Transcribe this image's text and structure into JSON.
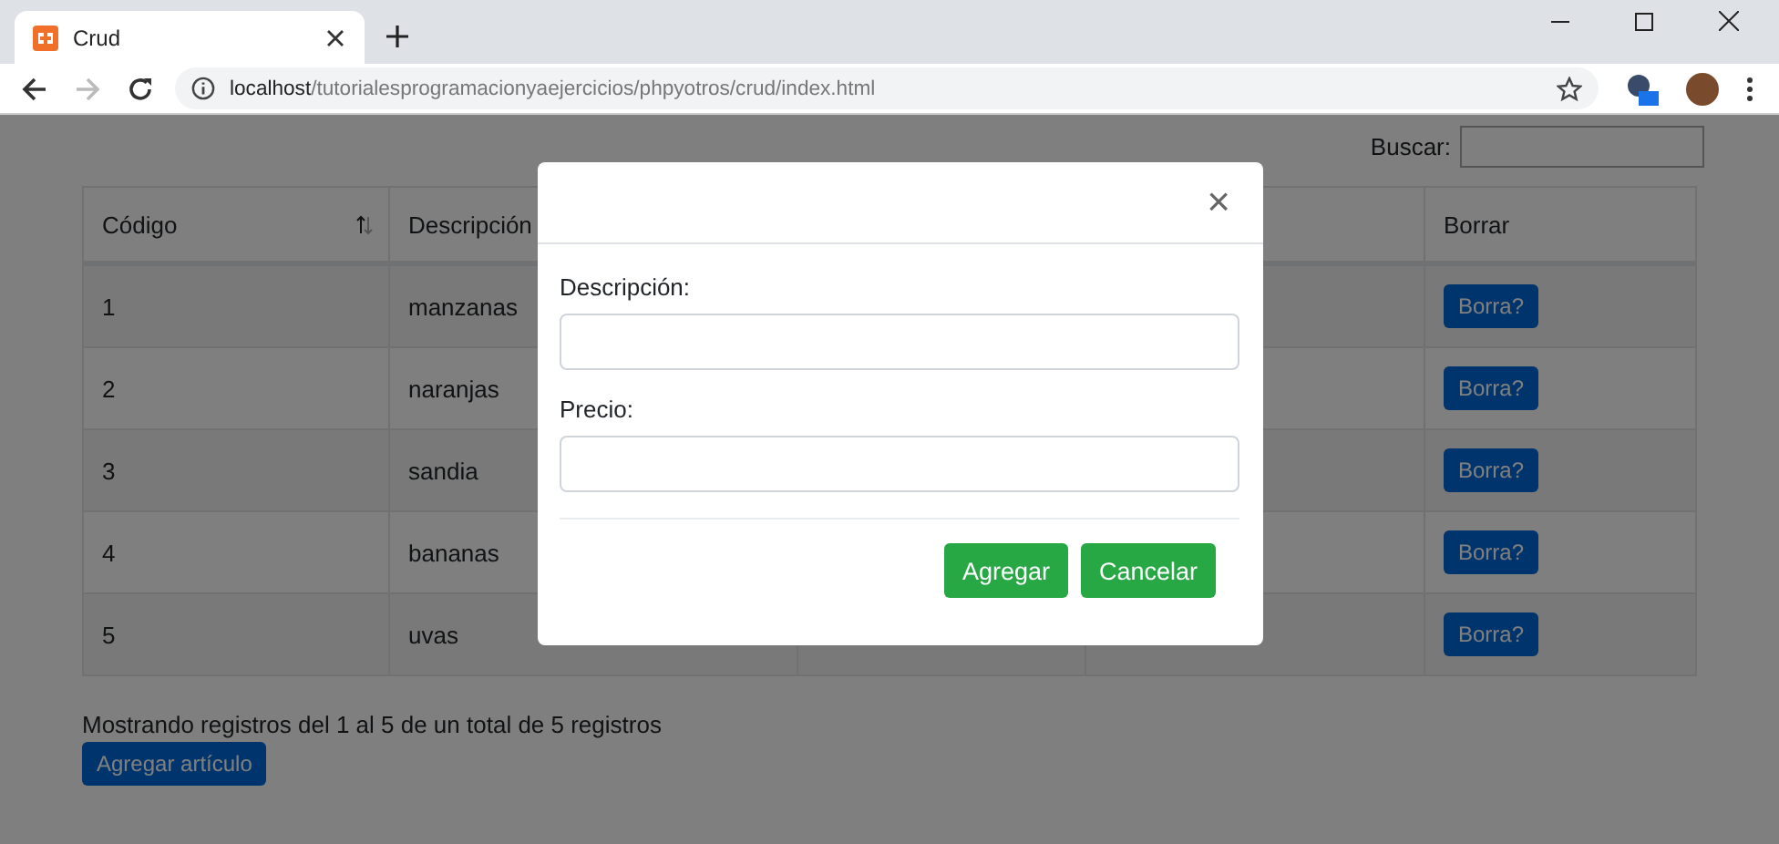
{
  "browser": {
    "tab_title": "Crud",
    "url_host": "localhost",
    "url_path": "/tutorialesprogramacionyaejercicios/phpyotros/crud/index.html",
    "forward_disabled": true
  },
  "search": {
    "label": "Buscar:"
  },
  "table": {
    "columns": [
      {
        "label": "Código",
        "sortable": true
      },
      {
        "label": "Descripción"
      },
      {
        "label": "Borrar"
      }
    ],
    "rows": [
      {
        "codigo": "1",
        "descripcion": "manzanas",
        "action": "Borra?"
      },
      {
        "codigo": "2",
        "descripcion": "naranjas",
        "action": "Borra?"
      },
      {
        "codigo": "3",
        "descripcion": "sandia",
        "action": "Borra?"
      },
      {
        "codigo": "4",
        "descripcion": "bananas",
        "action": "Borra?"
      },
      {
        "codigo": "5",
        "descripcion": "uvas",
        "action": "Borra?"
      }
    ]
  },
  "info": "Mostrando registros del 1 al 5 de un total de 5 registros",
  "add_button": "Agregar artículo",
  "modal": {
    "close": "×",
    "fields": [
      {
        "label": "Descripción:"
      },
      {
        "label": "Precio:"
      }
    ],
    "buttons": [
      "Agregar",
      "Cancelar"
    ]
  }
}
